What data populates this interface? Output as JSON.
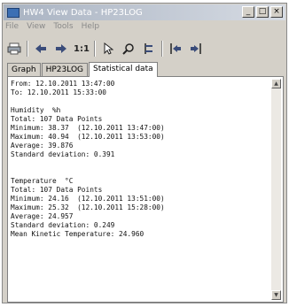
{
  "window": {
    "title": "HW4 View Data - HP23LOG"
  },
  "window_buttons": {
    "minimize": "_",
    "maximize": "□",
    "close": "×"
  },
  "menu": [
    "File",
    "View",
    "Tools",
    "Help"
  ],
  "toolbar": {
    "icons": [
      "print-icon",
      "arrow-left-icon",
      "arrow-right-icon",
      "zoom-1to1-icon",
      "pointer-icon",
      "magnifier-icon",
      "cursor-bracket-icon",
      "mark-start-icon",
      "mark-end-icon"
    ],
    "zoom_label": "1:1"
  },
  "tabs": [
    "Graph",
    "HP23LOG",
    "Statistical data"
  ],
  "active_tab": "Statistical data",
  "stats": {
    "lines": [
      "From: 12.10.2011 13:47:00",
      "To: 12.10.2011 15:33:00",
      "",
      "Humidity  %h",
      "Total: 107 Data Points",
      "Minimum: 38.37  (12.10.2011 13:47:00)",
      "Maximum: 40.94  (12.10.2011 13:53:00)",
      "Average: 39.876",
      "Standard deviation: 0.391",
      "",
      "",
      "Temperature  °C",
      "Total: 107 Data Points",
      "Minimum: 24.16  (12.10.2011 13:51:00)",
      "Maximum: 25.32  (12.10.2011 15:28:00)",
      "Average: 24.957",
      "Standard deviation: 0.249",
      "Mean Kinetic Temperature: 24.960"
    ]
  },
  "scrollbar": {
    "up_arrow": "▲",
    "down_arrow": "▼"
  }
}
